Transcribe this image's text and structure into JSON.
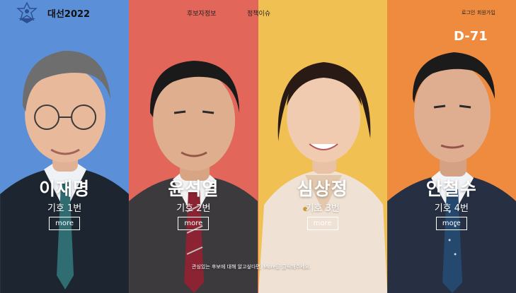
{
  "header": {
    "site_title": "대선2022",
    "logo_icon": "idol-emblem-icon",
    "nav": {
      "candidate_info": "후보자정보",
      "policy_issues": "정책이슈"
    },
    "auth": {
      "login": "로그인",
      "signup": "회원가입"
    },
    "dday": "D-71"
  },
  "candidates": [
    {
      "name": "이재명",
      "number": "기호 1번",
      "more": "more",
      "color": "#5b8fd8"
    },
    {
      "name": "윤석열",
      "number": "기호 2번",
      "more": "more",
      "color": "#e2665a"
    },
    {
      "name": "심상정",
      "number": "기호 3번",
      "more": "more",
      "color": "#f0c053"
    },
    {
      "name": "안철수",
      "number": "기호 4번",
      "more": "more",
      "color": "#ee8b3e"
    }
  ],
  "footer_note": "관심있는 후보에 대해 알고싶다면, More을 클릭해주세요."
}
